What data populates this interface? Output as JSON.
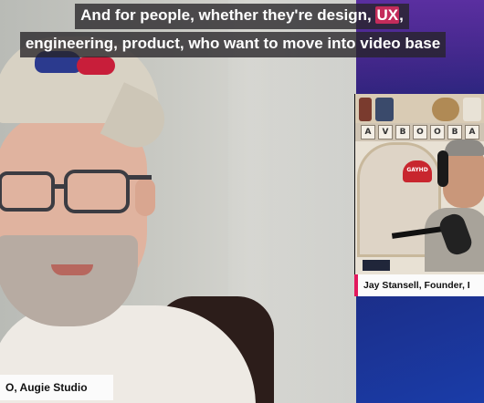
{
  "captions": {
    "line1_before": "And for people, whether they're design, ",
    "line1_highlight": "UX",
    "line1_after": ",",
    "line2": "engineering, product, who want to move into video base"
  },
  "speakers": {
    "main_name": "O, Augie Studio",
    "guest_name": "Jay Stansell, Founder, I"
  },
  "props": {
    "hat_text": "GAYHD",
    "letter_blocks": [
      "A",
      "V",
      "B",
      "O",
      "O",
      "B",
      "A"
    ]
  },
  "colors": {
    "caption_highlight": "#c42c5b",
    "name_accent": "#e2195d",
    "background_purple": "#3b1f7a",
    "background_blue": "#1a3ca8"
  }
}
